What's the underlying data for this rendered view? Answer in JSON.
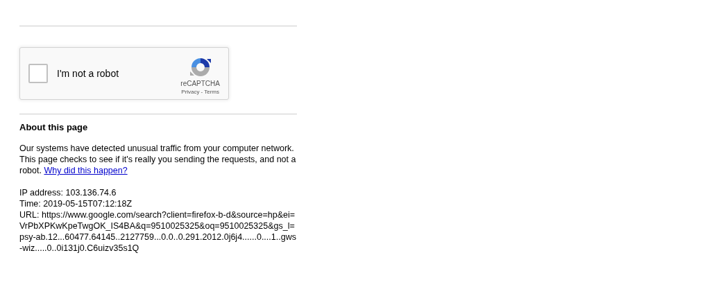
{
  "captcha": {
    "checked": false,
    "label": "I'm not a robot",
    "brand": "reCAPTCHA",
    "privacy_link": "Privacy",
    "separator": "-",
    "terms_link": "Terms"
  },
  "about": {
    "heading": "About this page",
    "message": "Our systems have detected unusual traffic from your computer network. This page checks to see if it's really you sending the requests, and not a robot.",
    "link": "Why did this happen?"
  },
  "details": {
    "ip": "IP address: 103.136.74.6",
    "time": "Time: 2019-05-15T07:12:18Z",
    "url": "URL: https://www.google.com/search?client=firefox-b-d&source=hp&ei=VrPbXPKwKpeTwgOK_IS4BA&q=9510025325&oq=9510025325&gs_l=psy-ab.12...60477.64145..2127759...0.0..0.291.2012.0j6j4......0....1..gws-wiz.....0..0i131j0.C6uizv35s1Q"
  }
}
